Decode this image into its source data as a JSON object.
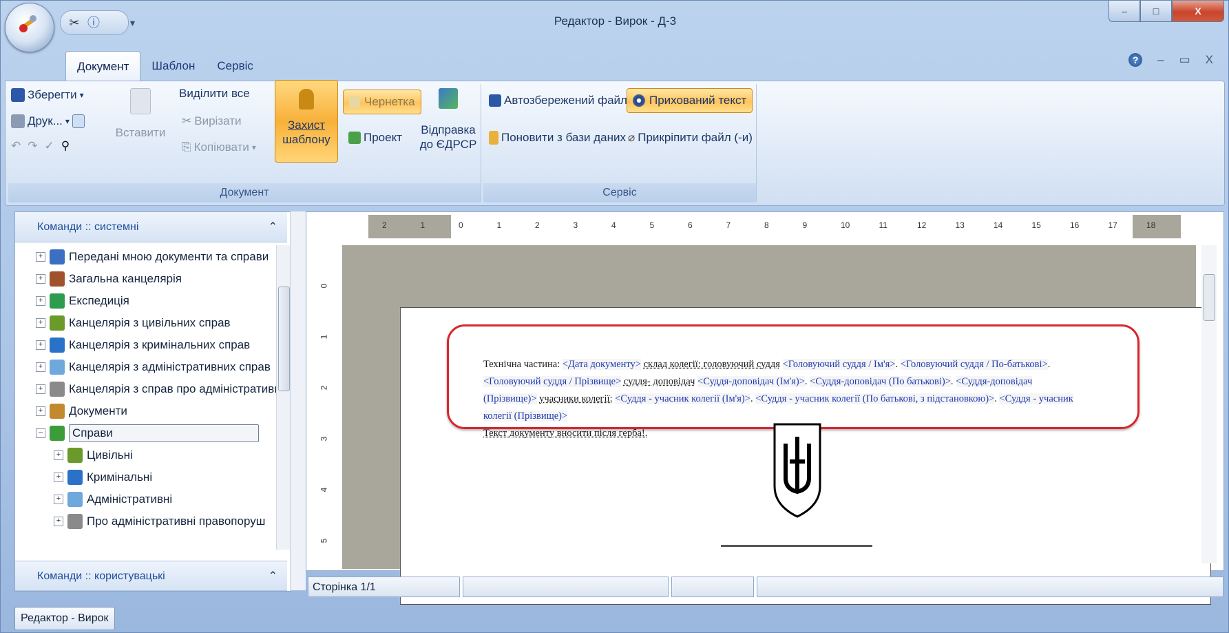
{
  "window": {
    "title": "Редактор - Вирок - Д-3",
    "controls": {
      "minimize": "–",
      "maximize": "□",
      "close": "X"
    }
  },
  "quick_access": {
    "dropdown": "▾"
  },
  "tabs": [
    "Документ",
    "Шаблон",
    "Сервіс"
  ],
  "tab_controls": {
    "minimize": "–",
    "restore": "▭",
    "close": "X",
    "help": "?"
  },
  "ribbon": {
    "document_group": {
      "label": "Документ",
      "save": "Зберегти",
      "print": "Друк...",
      "paste": "Вставити",
      "select_all": "Виділити все",
      "cut": "Вирізати",
      "copy": "Копіювати",
      "protect_line1": "Захист",
      "protect_line2": "шаблону",
      "draft": "Чернетка",
      "project": "Проект",
      "send_line1": "Відправка",
      "send_line2": "до ЄДРСР"
    },
    "service_group": {
      "label": "Сервіс",
      "autosave": "Автозбережений файл",
      "hidden_text": "Прихований текст",
      "update_db": "Поновити з бази даних",
      "attach": "Прикріпити файл (-и)"
    }
  },
  "left_panel": {
    "system_header": "Команди :: системні",
    "user_header": "Команди :: користувацькі",
    "tree": [
      {
        "label": "Передані мною документи та справи",
        "level": 0,
        "expander": "+",
        "icon_color": "#3b6fc2"
      },
      {
        "label": "Загальна канцелярія",
        "level": 0,
        "expander": "+",
        "icon_color": "#a0522d"
      },
      {
        "label": "Експедиція",
        "level": 0,
        "expander": "+",
        "icon_color": "#2e9c4f"
      },
      {
        "label": "Канцелярія з цивільних справ",
        "level": 0,
        "expander": "+",
        "icon_color": "#6a9a2a"
      },
      {
        "label": "Канцелярія з кримінальних справ",
        "level": 0,
        "expander": "+",
        "icon_color": "#2a72c8"
      },
      {
        "label": "Канцелярія з адміністративних справ",
        "level": 0,
        "expander": "+",
        "icon_color": "#6fa8dc"
      },
      {
        "label": "Канцелярія з справ про адміністративні",
        "level": 0,
        "expander": "+",
        "icon_color": "#8a8a8a"
      },
      {
        "label": "Документи",
        "level": 0,
        "expander": "+",
        "icon_color": "#c28a2c"
      },
      {
        "label": "Справи",
        "level": 0,
        "expander": "–",
        "icon_color": "#3a9d3a",
        "selected": true
      },
      {
        "label": "Цивільні",
        "level": 1,
        "expander": "+",
        "icon_color": "#6a9a2a"
      },
      {
        "label": "Кримінальні",
        "level": 1,
        "expander": "+",
        "icon_color": "#2a72c8"
      },
      {
        "label": "Адміністративні",
        "level": 1,
        "expander": "+",
        "icon_color": "#6fa8dc"
      },
      {
        "label": "Про адміністративні правопоруш",
        "level": 1,
        "expander": "+",
        "icon_color": "#8a8a8a"
      }
    ]
  },
  "document": {
    "tech_line1_a": "Технічна частина:",
    "f_date": "<Дата документу>",
    "t_board": "склад колегії: головуючий суддя",
    "f_chair_name": "<Головуючий суддя / Ім'я>",
    "f_chair_patr": "<Головуючий суддя / По-батькові>",
    "f_chair_surname": "<Головуючий суддя / Прізвище>",
    "t_reporter": "суддя- доповідач",
    "f_rep_name": "<Суддя-доповідач (Ім'я)>",
    "f_rep_patr": "<Суддя-доповідач (По батькові)>",
    "f_rep_surname": "<Суддя-доповідач (Прізвище)>",
    "t_members": "учасники колегії:",
    "f_mem_name": "<Суддя - учасник колегії (Ім'я)>",
    "f_mem_patr": "<Суддя - учасник колегії (По батькові, з підстановкою)>",
    "f_mem_surname": "<Суддя - учасник колегії (Прізвище)>",
    "note": "Текст документу вносити після герба!."
  },
  "ruler": {
    "h_ticks": [
      "2",
      "1",
      "0",
      "1",
      "2",
      "3",
      "4",
      "5",
      "6",
      "7",
      "8",
      "9",
      "10",
      "11",
      "12",
      "13",
      "14",
      "15",
      "16",
      "17",
      "18"
    ],
    "v_ticks": [
      "0",
      "1",
      "2",
      "3",
      "4",
      "5"
    ]
  },
  "status": {
    "page": "Сторінка 1/1"
  },
  "taskbar": {
    "item": "Редактор - Вирок"
  }
}
